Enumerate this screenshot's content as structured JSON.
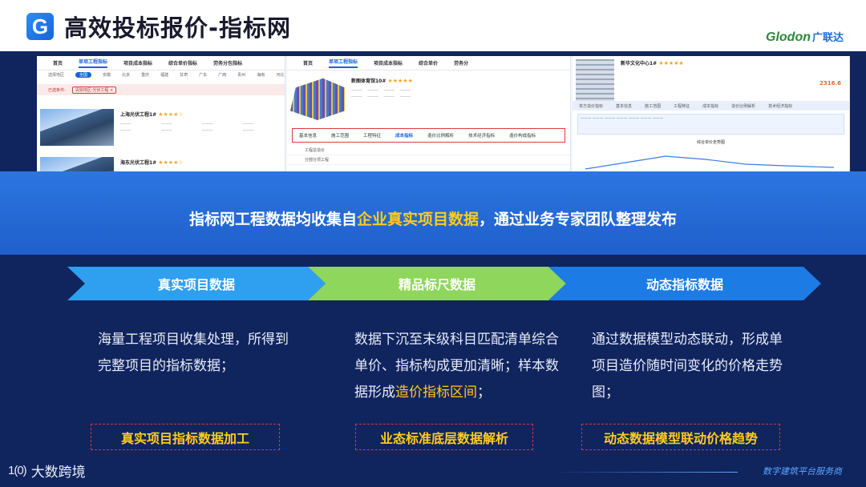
{
  "header": {
    "logo_letter": "G",
    "title": "高效投标报价-指标网",
    "brand_en": "Glodon",
    "brand_cn": "广联达"
  },
  "shot1": {
    "nav": [
      "首页",
      "单项工程指标",
      "项目成本指标",
      "综合单价指标",
      "劳务分包指标"
    ],
    "filter_label": "选择地区",
    "filter_all": "全国",
    "regions": [
      "安徽",
      "北京",
      "重庆",
      "福建",
      "甘肃",
      "广东",
      "广西",
      "贵州",
      "海南",
      "河北"
    ],
    "tag_label": "已选条件:",
    "tag_value": "清除地区:光伏工程 ×",
    "cards": [
      {
        "title": "上海光伏工程1#",
        "stars": "★★★★☆"
      },
      {
        "title": "海东光伏工程1#",
        "stars": "★★★★☆"
      }
    ]
  },
  "shot2": {
    "nav": [
      "首页",
      "单项工程指标",
      "项目成本指标",
      "综合单价",
      "劳务分"
    ],
    "project_title": "新图体育馆10#",
    "stars": "★★★★★",
    "tabs": [
      "基本信息",
      "施工范围",
      "工程特征",
      "成本指标",
      "造价比例解析",
      "技术经济指标",
      "造价构成指标"
    ],
    "rows": [
      "工程总造价",
      "分部分项工程"
    ]
  },
  "shot3": {
    "title": "新华文化中心1#",
    "stars": "★★★★★",
    "price": "2316.6",
    "tabs": [
      "单方造价指标",
      "基本信息",
      "施工范围",
      "工程特征",
      "成本指标",
      "造价比例解析",
      "技术经济指标"
    ],
    "chart_title": "综合单价走势图"
  },
  "banner": {
    "text_before": "指标网工程数据均收集自",
    "text_highlight": "企业真实项目数据",
    "text_after": "，通过业务专家团队整理发布"
  },
  "steps": [
    {
      "label": "真实项目数据",
      "color": "#2f9ff0"
    },
    {
      "label": "精品标尺数据",
      "color": "#8ed65c"
    },
    {
      "label": "动态指标数据",
      "color": "#1d7be6"
    }
  ],
  "columns": {
    "col1": {
      "text": "海量工程项目收集处理，所得到完整项目的指标数据；"
    },
    "col2": {
      "text_before": "数据下沉至末级科目匹配清单综合单价、指标构成更加清晰；样本数据形成",
      "highlight": "造价指标区间",
      "text_after": "；"
    },
    "col3": {
      "text": "通过数据模型动态联动，形成单项目造价随时间变化的价格走势图；"
    }
  },
  "tags": [
    "真实项目指标数据加工",
    "业态标准底层数据解析",
    "动态数据模型联动价格趋势"
  ],
  "footer": {
    "logo_mark": "1(0)",
    "logo_text": "大数跨境",
    "right_text": "数字建筑平台服务商"
  },
  "colors": {
    "accent_yellow": "#ffcc1a",
    "dash_red": "#d03a3a",
    "bg": "#10245e"
  }
}
